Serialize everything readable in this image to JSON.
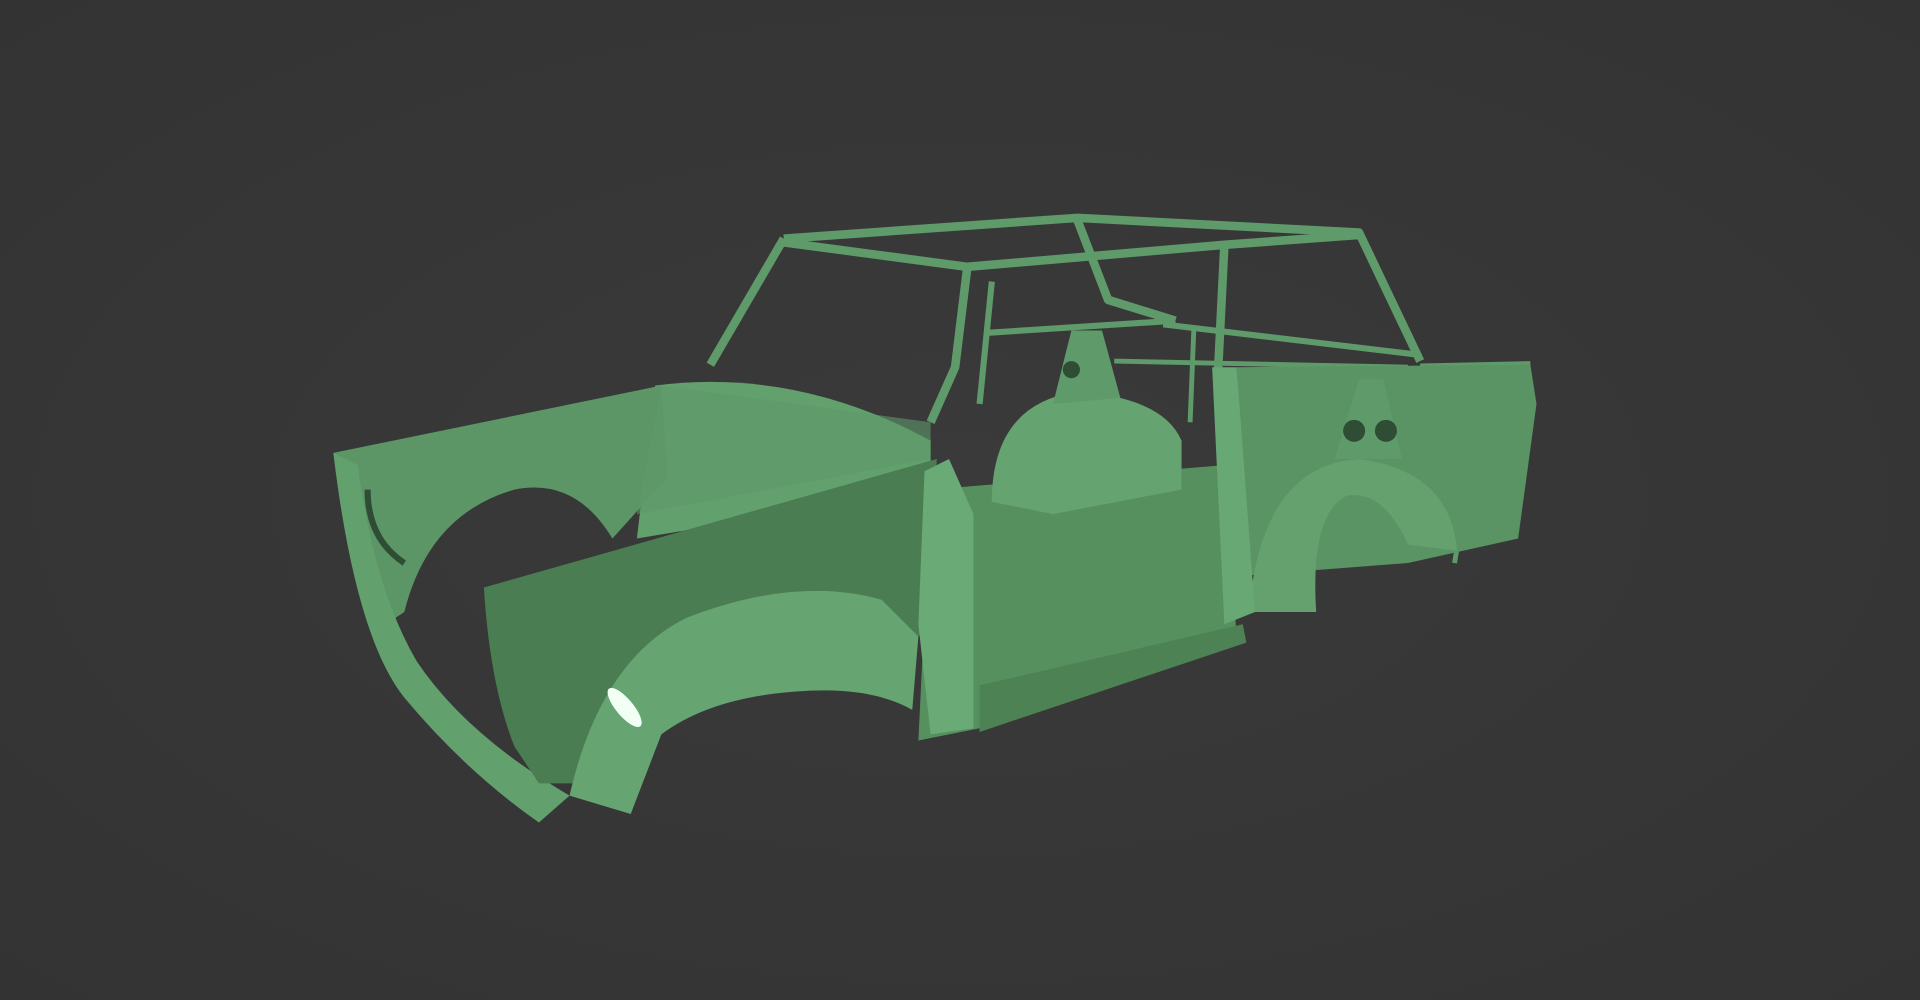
{
  "scene": {
    "subject": "car-body-shell",
    "colors": {
      "background": "#373737",
      "body_base": "#5f9a6a",
      "body_light": "#6fae7a",
      "body_shadow": "#44704c",
      "body_dark": "#2f4d35",
      "highlight": "#f2fff4"
    }
  }
}
